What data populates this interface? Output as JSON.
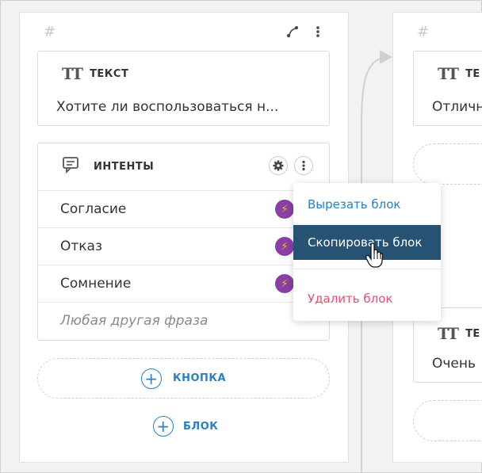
{
  "left_card": {
    "hash": "#",
    "text_block": {
      "title": "ТЕКСТ",
      "content": "Хотите ли воспользоваться н..."
    },
    "intents_block": {
      "title": "ИНТЕНТЫ",
      "rows": [
        {
          "label": "Согласие"
        },
        {
          "label": "Отказ"
        },
        {
          "label": "Сомнение"
        }
      ],
      "fallback": "Любая другая фраза"
    },
    "button_label": "КНОПКА",
    "add_block_label": "БЛОК"
  },
  "right_card": {
    "hash": "#",
    "block1": {
      "title": "ТЕ",
      "content": "Отличн"
    },
    "block2": {
      "title": "ТЕ",
      "content": "Очень"
    }
  },
  "context_menu": {
    "cut": "Вырезать блок",
    "copy": "Скопировать блок",
    "delete": "Удалить блок"
  },
  "colors": {
    "accent": "#2a80c3",
    "menu_selected": "#265373",
    "danger": "#e0516f",
    "bolt_bg": "#8a3fa6"
  }
}
